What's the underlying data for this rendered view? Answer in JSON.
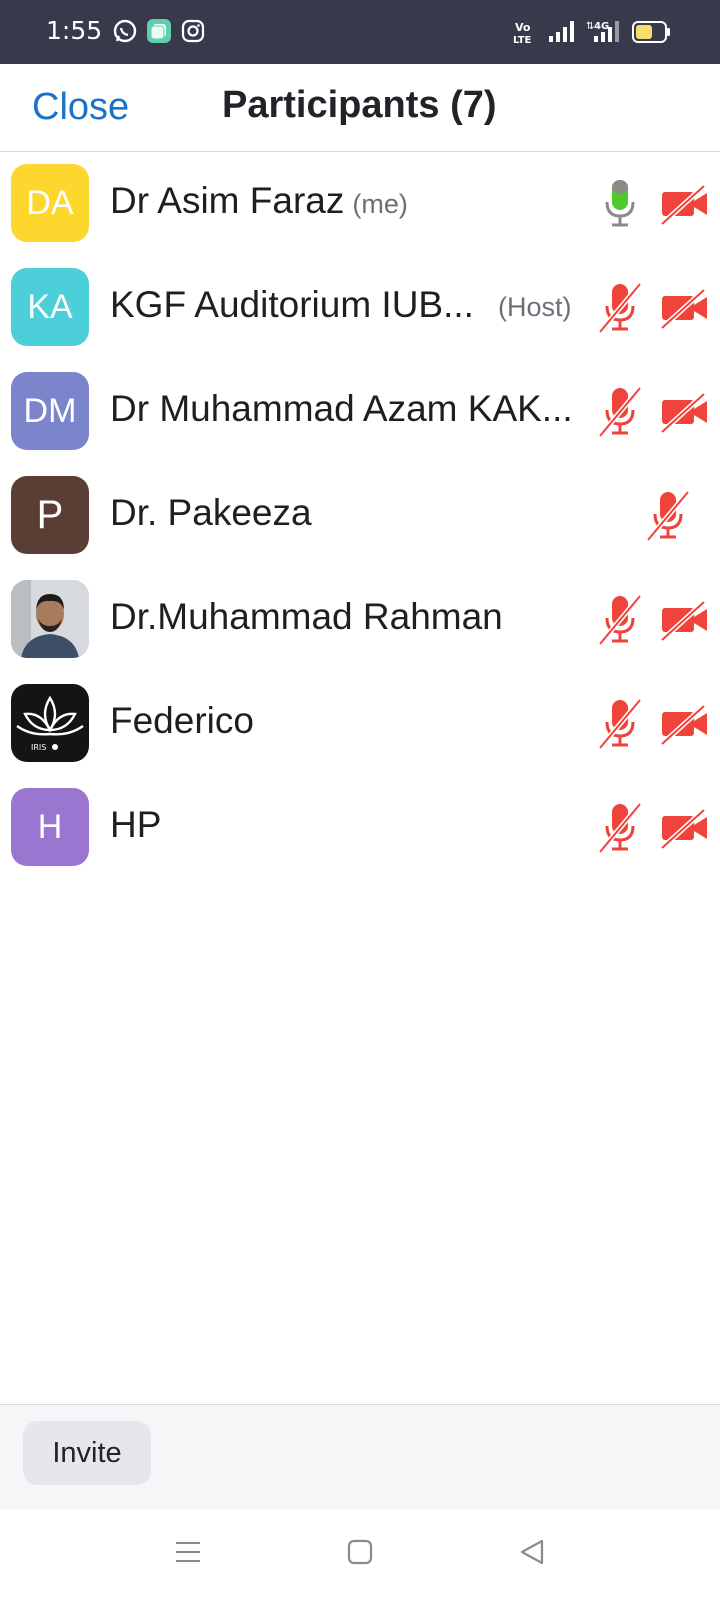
{
  "status_bar": {
    "time": "1:55",
    "icons": [
      "whatsapp-icon",
      "app-icon",
      "instagram-icon",
      "volte-icon",
      "signal-icon",
      "4g-signal-icon",
      "battery-icon"
    ],
    "volte_text_top": "Vo",
    "volte_text_bottom": "LTE",
    "network_text": "4G",
    "battery_level": 0.6
  },
  "header": {
    "close_label": "Close",
    "title": "Participants (7)"
  },
  "participants": [
    {
      "initials": "DA",
      "name": "Dr Asim Faraz",
      "tag": "(me)",
      "avatar_color": "#fdd72e",
      "mic": "on",
      "video": "off"
    },
    {
      "initials": "KA",
      "name": "KGF Auditorium IUB...",
      "tag": "(Host)",
      "avatar_color": "#4ccfd9",
      "mic": "muted",
      "video": "off"
    },
    {
      "initials": "DM",
      "name": "Dr Muhammad Azam KAK...",
      "tag": "",
      "avatar_color": "#7c85cc",
      "mic": "muted",
      "video": "off"
    },
    {
      "initials": "P",
      "name": "Dr. Pakeeza",
      "tag": "",
      "avatar_color": "#5a3e35",
      "mic": "muted",
      "video": "none"
    },
    {
      "initials": "",
      "name": "Dr.Muhammad Rahman",
      "tag": "",
      "avatar_color": "#c9cdd2",
      "mic": "muted",
      "video": "off"
    },
    {
      "initials": "",
      "name": "Federico",
      "tag": "",
      "avatar_color": "#141414",
      "logo_text": "IRIS",
      "mic": "muted",
      "video": "off"
    },
    {
      "initials": "H",
      "name": "HP",
      "tag": "",
      "avatar_color": "#9a76d1",
      "mic": "muted",
      "video": "off"
    }
  ],
  "footer": {
    "invite_label": "Invite"
  },
  "colors": {
    "accent_blue": "#1a73c8",
    "muted_red": "#f0433a",
    "mic_on_green": "#4ec92a",
    "status_bar_bg": "#383a4b"
  }
}
